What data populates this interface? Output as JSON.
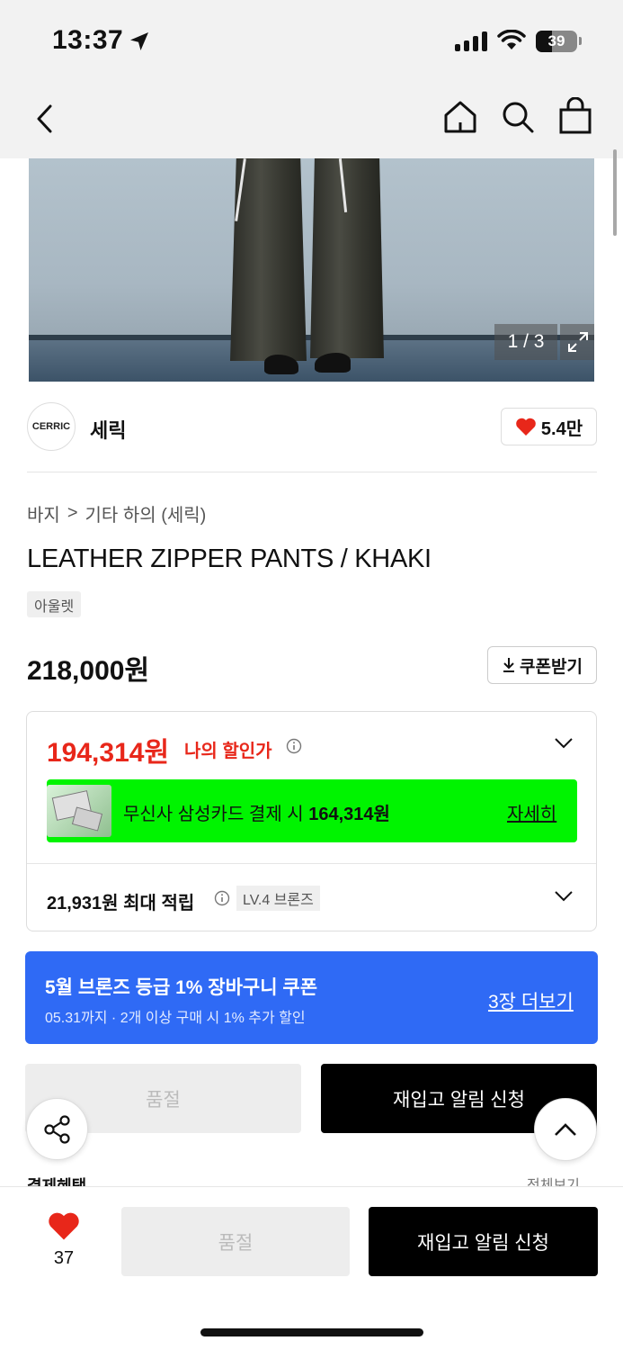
{
  "status_bar": {
    "time": "13:37",
    "battery": "39",
    "battery_level": 0.39
  },
  "image_gallery": {
    "counter": "1 / 3"
  },
  "brand": {
    "logo_text": "CERRIC",
    "name": "세릭",
    "likes": "5.4만"
  },
  "breadcrumb": {
    "category": "바지",
    "separator": ">",
    "subcategory": "기타 하의 (세릭)"
  },
  "product": {
    "title": "LEATHER ZIPPER PANTS / KHAKI",
    "badge": "아울렛",
    "price": "218,000원"
  },
  "coupon_button": {
    "label": "쿠폰받기"
  },
  "discount": {
    "my_price": "194,314원",
    "my_price_label": "나의 할인가",
    "card_prefix": "무신사 삼성카드 결제 시",
    "card_price": "164,314원",
    "card_link": "자세히",
    "points": "21,931원 최대 적립",
    "level": "LV.4 브론즈"
  },
  "coupon_banner": {
    "title": "5월 브론즈 등급 1% 장바구니 쿠폰",
    "subtitle": "05.31까지 · 2개 이상 구매 시 1% 추가 할인",
    "link": "3장 더보기"
  },
  "buttons": {
    "sold_out": "품절",
    "restock": "재입고 알림 신청"
  },
  "peek": {
    "left": "결제혜택",
    "right": "전체보기"
  },
  "bottom_bar": {
    "like_count": "37",
    "sold_out": "품절",
    "restock": "재입고 알림 신청"
  },
  "colors": {
    "accent_red": "#e8271a",
    "card_green": "#00f400",
    "coupon_blue": "#2f6af5"
  }
}
